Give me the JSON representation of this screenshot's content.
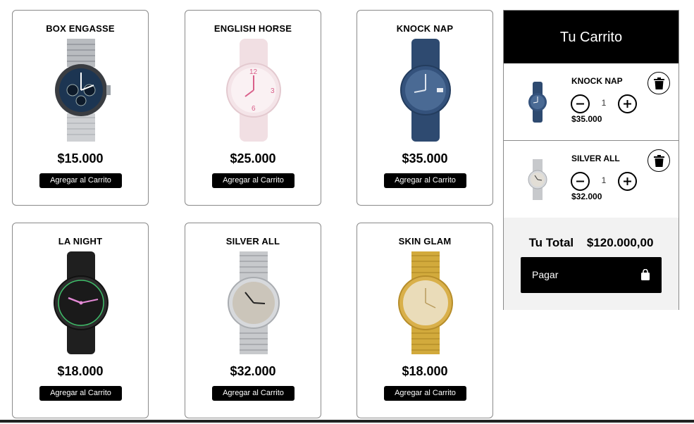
{
  "products": [
    {
      "name": "BOX ENGASSE",
      "price": "$15.000",
      "button": "Agregar al Carrito"
    },
    {
      "name": "ENGLISH HORSE",
      "price": "$25.000",
      "button": "Agregar al Carrito"
    },
    {
      "name": "KNOCK NAP",
      "price": "$35.000",
      "button": "Agregar al Carrito"
    },
    {
      "name": "LA NIGHT",
      "price": "$18.000",
      "button": "Agregar al Carrito"
    },
    {
      "name": "SILVER ALL",
      "price": "$32.000",
      "button": "Agregar al Carrito"
    },
    {
      "name": "SKIN GLAM",
      "price": "$18.000",
      "button": "Agregar al Carrito"
    }
  ],
  "cart": {
    "title": "Tu Carrito",
    "items": [
      {
        "name": "KNOCK NAP",
        "quantity": "1",
        "price": "$35.000"
      },
      {
        "name": "SILVER ALL",
        "quantity": "1",
        "price": "$32.000"
      }
    ],
    "total_label": "Tu Total",
    "total_value": "$120.000,00",
    "pay_label": "Pagar"
  },
  "icons": {
    "minus": "minus-icon",
    "plus": "plus-icon",
    "trash": "trash-icon",
    "bag": "shopping-bag-icon"
  },
  "colors": {
    "primary": "#000000",
    "border": "#8a8a8a",
    "footer_bg": "#f2f2f2"
  }
}
